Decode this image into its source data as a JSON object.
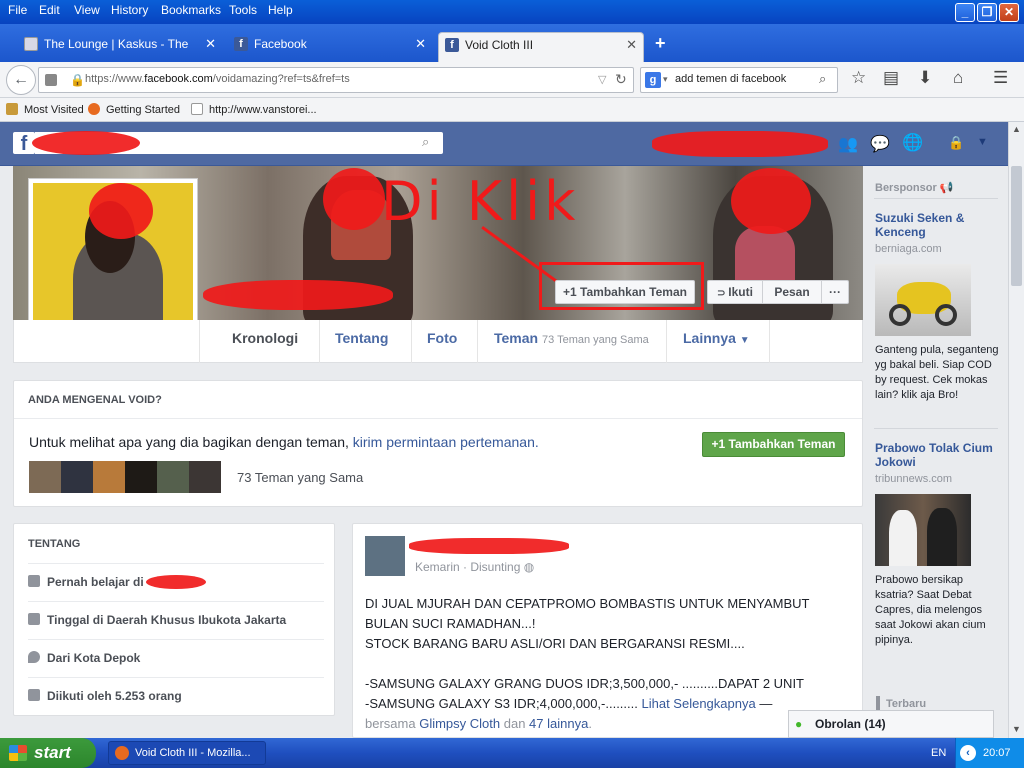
{
  "menu": [
    "File",
    "Edit",
    "View",
    "History",
    "Bookmarks",
    "Tools",
    "Help"
  ],
  "tabs": [
    {
      "label": "The Lounge | Kaskus - The La...",
      "icon": "kaskus-icon",
      "active": false
    },
    {
      "label": "Facebook",
      "icon": "facebook-icon",
      "active": false
    },
    {
      "label": "Void Cloth III",
      "icon": "facebook-icon",
      "active": true
    }
  ],
  "nav": {
    "url_prefix": "https://www.",
    "url_domain": "facebook.com",
    "url_rest": "/voidamazing?ref=ts&fref=ts",
    "search_value": "add temen di facebook"
  },
  "bookmarks": [
    "Most Visited",
    "Getting Started",
    "http://www.vanstorei..."
  ],
  "profile": {
    "annotation": "Di Klik",
    "add_friend_label": "Tambahkan Teman",
    "follow_label": "Ikuti",
    "message_label": "Pesan",
    "more_label": "···"
  },
  "profile_nav": {
    "timeline": "Kronologi",
    "about": "Tentang",
    "photos": "Foto",
    "friends": "Teman",
    "friends_sub": "73 Teman yang Sama",
    "more": "Lainnya"
  },
  "know_card": {
    "heading": "ANDA MENGENAL VOID?",
    "text": "Untuk melihat apa yang dia bagikan dengan teman, ",
    "link": "kirim permintaan pertemanan.",
    "button": "+1 Tambahkan Teman",
    "mutual": "73 Teman yang Sama"
  },
  "about_card": {
    "heading": "TENTANG",
    "rows": [
      {
        "icon": "school-icon",
        "text": "Pernah belajar di"
      },
      {
        "icon": "home-icon",
        "text": "Tinggal di Daerah Khusus Ibukota Jakarta"
      },
      {
        "icon": "location-pin-icon",
        "text": "Dari Kota Depok"
      },
      {
        "icon": "rss-icon",
        "text": "Diikuti oleh 5.253 orang"
      }
    ]
  },
  "post": {
    "meta": "Kemarin · Disunting",
    "lines": [
      "DI JUAL MJURAH DAN CEPATPROMO BOMBASTIS UNTUK MENYAMBUT",
      "BULAN SUCI RAMADHAN...!",
      "STOCK BARANG BARU ASLI/ORI DAN BERGARANSI RESMI....",
      "",
      "-SAMSUNG GALAXY GRANG DUOS IDR;3,500,000,- ..........DAPAT 2 UNIT",
      "-SAMSUNG GALAXY S3 IDR;4,000,000,-........."
    ],
    "see_more": "Lihat Selengkapnya",
    "with_prefix": " — ",
    "with_line_a": "bersama ",
    "with_name": "Glimpsy Cloth",
    "with_and": " dan ",
    "with_others": "47 lainnya",
    "with_end": "."
  },
  "rail": {
    "sponsored": "Bersponsor",
    "ads": [
      {
        "title": "Suzuki Seken & Kenceng",
        "domain": "berniaga.com",
        "text": "Ganteng pula, seganteng yg bakal beli. Siap COD by request. Cek mokas lain? klik aja Bro!"
      },
      {
        "title": "Prabowo Tolak Cium Jokowi",
        "domain": "tribunnews.com",
        "text": "Prabowo bersikap ksatria? Saat Debat Capres, dia melengos saat Jokowi akan cium pipinya."
      }
    ],
    "more_label": "Terbaru"
  },
  "chat": {
    "label": "Obrolan (14)"
  },
  "taskbar": {
    "start": "start",
    "item": "Void Cloth III - Mozilla...",
    "lang": "EN",
    "time": "20:07"
  }
}
